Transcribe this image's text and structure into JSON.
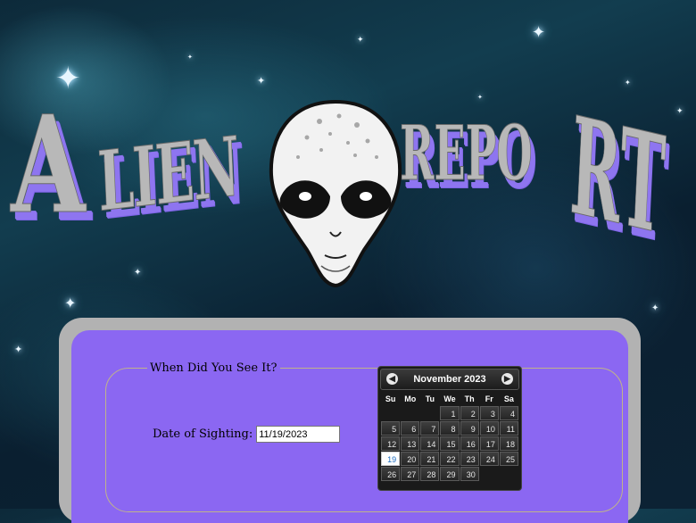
{
  "title": {
    "word_left": "ALIEN",
    "word_right": "REPORT",
    "colors": {
      "text": "#b8b8b8",
      "shadow": "#8e75f0"
    }
  },
  "form": {
    "legend": "When Did You See It?",
    "date_label": "Date of Sighting:",
    "date_value": "11/19/2023"
  },
  "datepicker": {
    "month_title": "November 2023",
    "prev_icon": "chevron-left-icon",
    "next_icon": "chevron-right-icon",
    "weekdays": [
      "Su",
      "Mo",
      "Tu",
      "We",
      "Th",
      "Fr",
      "Sa"
    ],
    "weeks": [
      [
        "",
        "",
        "",
        "1",
        "2",
        "3",
        "4"
      ],
      [
        "5",
        "6",
        "7",
        "8",
        "9",
        "10",
        "11"
      ],
      [
        "12",
        "13",
        "14",
        "15",
        "16",
        "17",
        "18"
      ],
      [
        "19",
        "20",
        "21",
        "22",
        "23",
        "24",
        "25"
      ],
      [
        "26",
        "27",
        "28",
        "29",
        "30",
        "",
        ""
      ]
    ],
    "selected_day": "19"
  },
  "colors": {
    "panel_border": "#b2b2b2",
    "panel_fill": "#8b67f2",
    "calendar_bg": "#1a1a1a"
  }
}
